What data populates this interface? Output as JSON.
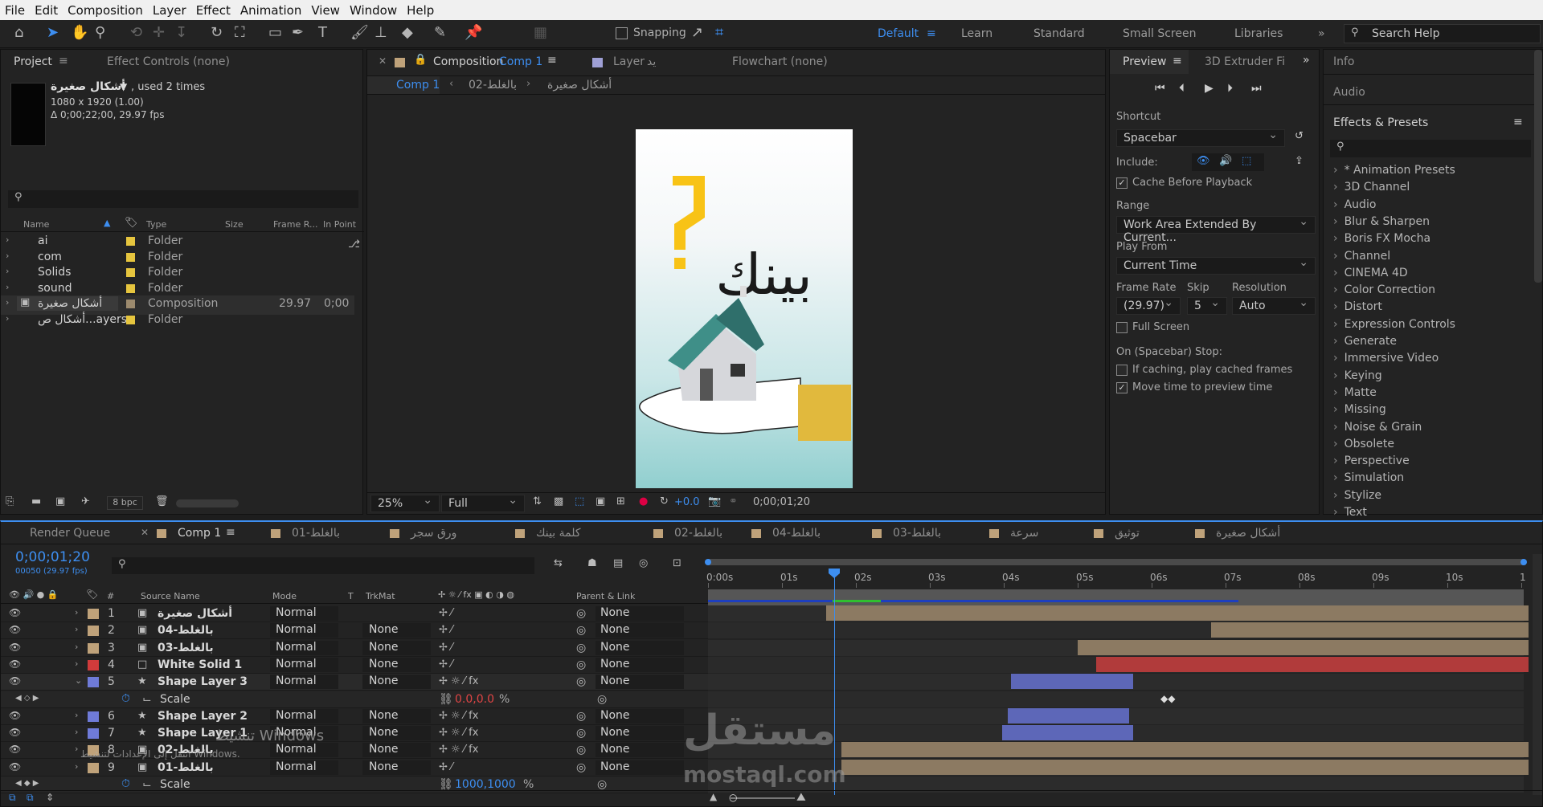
{
  "menu": [
    "File",
    "Edit",
    "Composition",
    "Layer",
    "Effect",
    "Animation",
    "View",
    "Window",
    "Help"
  ],
  "toolbar": {
    "snapping_label": "Snapping",
    "workspaces": [
      "Default",
      "Learn",
      "Standard",
      "Small Screen",
      "Libraries"
    ],
    "active_workspace": "Default",
    "search_placeholder": "Search Help"
  },
  "project": {
    "tabs": [
      "Project",
      "Effect Controls (none)"
    ],
    "selected_name": "أشكال صغيرة",
    "used": ", used 2 times",
    "dims": "1080 x 1920 (1.00)",
    "duration": "Δ 0;00;22;00, 29.97 fps",
    "columns": [
      "Name",
      "Type",
      "Size",
      "Frame R...",
      "In Point"
    ],
    "items": [
      {
        "name": "ai",
        "type": "Folder",
        "fps": "",
        "in": "",
        "color": "#e6c53e"
      },
      {
        "name": "com",
        "type": "Folder",
        "fps": "",
        "in": "",
        "color": "#e6c53e"
      },
      {
        "name": "Solids",
        "type": "Folder",
        "fps": "",
        "in": "",
        "color": "#e6c53e"
      },
      {
        "name": "sound",
        "type": "Folder",
        "fps": "",
        "in": "",
        "color": "#e6c53e"
      },
      {
        "name": "أشكال صغيرة",
        "type": "Composition",
        "fps": "29.97",
        "in": "0;00",
        "color": "#9c8a6e"
      },
      {
        "name": "أشكال ص...ayers",
        "type": "Folder",
        "fps": "",
        "in": "",
        "color": "#e6c53e"
      }
    ],
    "bpc": "8 bpc"
  },
  "composition": {
    "tab_label": "Composition",
    "tab_comp": "Comp 1",
    "layer_tab": "Layer",
    "layer_name": "يد",
    "flowchart": "Flowchart (none)",
    "breadcrumbs": [
      "Comp 1",
      "بالغلط-02",
      "أشكال صغيرة"
    ],
    "artwork_text": "بينك",
    "zoom": "25%",
    "resolution": "Full",
    "exposure": "+0.0",
    "timecode": "0;00;01;20"
  },
  "preview": {
    "tabs": [
      "Preview",
      "3D Extruder Fi"
    ],
    "shortcut_label": "Shortcut",
    "shortcut_value": "Spacebar",
    "include_label": "Include:",
    "cache_before": "Cache Before Playback",
    "range_label": "Range",
    "range_value": "Work Area Extended By Current...",
    "play_from_label": "Play From",
    "play_from_value": "Current Time",
    "frame_rate_label": "Frame Rate",
    "skip_label": "Skip",
    "resolution_label": "Resolution",
    "frame_rate_value": "(29.97)",
    "skip_value": "5",
    "resolution_value": "Auto",
    "full_screen": "Full Screen",
    "on_stop": "On (Spacebar) Stop:",
    "if_caching": "If caching, play cached frames",
    "move_time": "Move time to preview time"
  },
  "right_panel": {
    "info": "Info",
    "audio": "Audio",
    "effects_title": "Effects & Presets",
    "effects": [
      "* Animation Presets",
      "3D Channel",
      "Audio",
      "Blur & Sharpen",
      "Boris FX Mocha",
      "Channel",
      "CINEMA 4D",
      "Color Correction",
      "Distort",
      "Expression Controls",
      "Generate",
      "Immersive Video",
      "Keying",
      "Matte",
      "Missing",
      "Noise & Grain",
      "Obsolete",
      "Perspective",
      "Simulation",
      "Stylize",
      "Text"
    ]
  },
  "timeline": {
    "tabs": [
      "Render Queue",
      "Comp 1",
      "بالغلط-01",
      "ورق سجر",
      "كلمة بينك",
      "بالغلط-02",
      "بالغلط-04",
      "بالغلط-03",
      "سرعة",
      "توثيق",
      "أشكال صغيرة"
    ],
    "timecode": "0;00;01;20",
    "frames": "00050 (29.97 fps)",
    "columns": {
      "source": "Source Name",
      "mode": "Mode",
      "t": "T",
      "trkmat": "TrkMat",
      "parent": "Parent & Link"
    },
    "ruler": [
      "0:00s",
      "01s",
      "02s",
      "03s",
      "04s",
      "05s",
      "06s",
      "07s",
      "08s",
      "09s",
      "10s",
      "1"
    ],
    "layers": [
      {
        "num": "1",
        "name": "أشكال صغيرة",
        "mode": "Normal",
        "trk": "",
        "parent": "None",
        "color": "#bfa27a",
        "icon": "comp"
      },
      {
        "num": "2",
        "name": "بالغلط-04",
        "mode": "Normal",
        "trk": "None",
        "parent": "None",
        "color": "#bfa27a",
        "icon": "comp"
      },
      {
        "num": "3",
        "name": "بالغلط-03",
        "mode": "Normal",
        "trk": "None",
        "parent": "None",
        "color": "#bfa27a",
        "icon": "comp"
      },
      {
        "num": "4",
        "name": "White Solid 1",
        "mode": "Normal",
        "trk": "None",
        "parent": "None",
        "color": "#d13b3b",
        "icon": "solid"
      },
      {
        "num": "5",
        "name": "Shape Layer 3",
        "mode": "Normal",
        "trk": "None",
        "parent": "None",
        "color": "#6f7bd8",
        "icon": "star"
      },
      {
        "num": "6",
        "name": "Shape Layer 2",
        "mode": "Normal",
        "trk": "None",
        "parent": "None",
        "color": "#6f7bd8",
        "icon": "star"
      },
      {
        "num": "7",
        "name": "Shape Layer 1",
        "mode": "Normal",
        "trk": "None",
        "parent": "None",
        "color": "#6f7bd8",
        "icon": "star"
      },
      {
        "num": "8",
        "name": "بالغلط-02",
        "mode": "Normal",
        "trk": "None",
        "parent": "None",
        "color": "#bfa27a",
        "icon": "comp"
      },
      {
        "num": "9",
        "name": "بالغلط-01",
        "mode": "Normal",
        "trk": "None",
        "parent": "None",
        "color": "#bfa27a",
        "icon": "comp"
      }
    ],
    "scale_label": "Scale",
    "scale_value_1": "0.0,0.0",
    "scale_value_2": "1000,1000",
    "percent": "%"
  },
  "watermark": {
    "win_activate": "تنشيط Windows",
    "win_settings": "انتقل إلى الإعدادات لتنشيط Windows.",
    "brand": "مستقل",
    "brand_url": "mostaql.com"
  },
  "colors": {
    "accent": "#2d8ceb",
    "folder": "#e6c53e",
    "playhead": "#3d8ef0"
  }
}
